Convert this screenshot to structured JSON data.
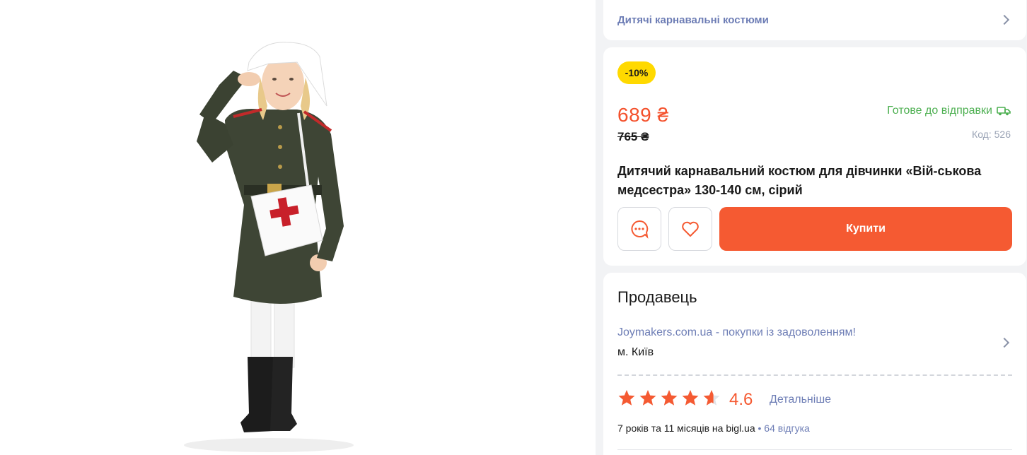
{
  "breadcrumb": {
    "label": "Дитячі карнавальні костюми"
  },
  "offer": {
    "discount": "-10%",
    "price": "689 ₴",
    "old_price": "765 ₴",
    "availability": "Готове до відправки",
    "code": "Код: 526",
    "title": "Дитячий карнавальний костюм для дівчинки «Вій-ськова медсестра» 130-140 см, сірий",
    "buy_label": "Купити"
  },
  "seller": {
    "heading": "Продавець",
    "name": "Joymakers.com.ua - покупки із задоволенням!",
    "city": "м. Київ",
    "rating": "4.6",
    "rating_fraction": 0.92,
    "details_label": "Детальніше",
    "since_text": "7 років та 11 місяців на bigl.ua",
    "reviews_text": "• 64 відгука"
  },
  "colors": {
    "accent": "#f55a32",
    "price": "#f4512c",
    "link": "#6d7db5",
    "ready": "#4caf50",
    "badge": "#ffd900"
  },
  "icons": {
    "chat": "chat-bubble-icon",
    "favorite": "heart-icon",
    "delivery": "truck-icon",
    "chevron": "chevron-right-icon"
  }
}
